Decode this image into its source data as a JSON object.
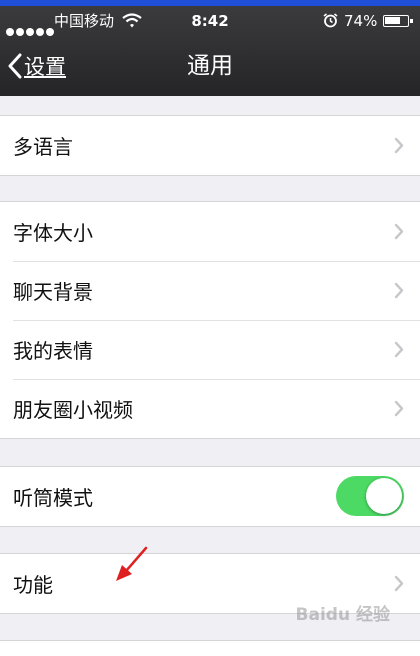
{
  "status_bar": {
    "carrier": "中国移动",
    "time": "8:42",
    "battery": "74%",
    "battery_level": 0.74,
    "icons": [
      "signal-dots-icon",
      "wifi-icon",
      "alarm-icon",
      "battery-icon"
    ]
  },
  "nav": {
    "back_label": "设置",
    "title": "通用"
  },
  "groups": [
    {
      "items": [
        {
          "label": "多语言",
          "accessory": "chevron"
        }
      ]
    },
    {
      "items": [
        {
          "label": "字体大小",
          "accessory": "chevron"
        },
        {
          "label": "聊天背景",
          "accessory": "chevron"
        },
        {
          "label": "我的表情",
          "accessory": "chevron"
        },
        {
          "label": "朋友圈小视频",
          "accessory": "chevron"
        }
      ]
    },
    {
      "items": [
        {
          "label": "听筒模式",
          "accessory": "toggle",
          "toggle_on": true
        }
      ]
    },
    {
      "items": [
        {
          "label": "功能",
          "accessory": "chevron"
        }
      ]
    }
  ],
  "watermark": "Baidu 经验",
  "colors": {
    "toggle_on": "#4cd964",
    "annotation_arrow": "#e02020"
  }
}
